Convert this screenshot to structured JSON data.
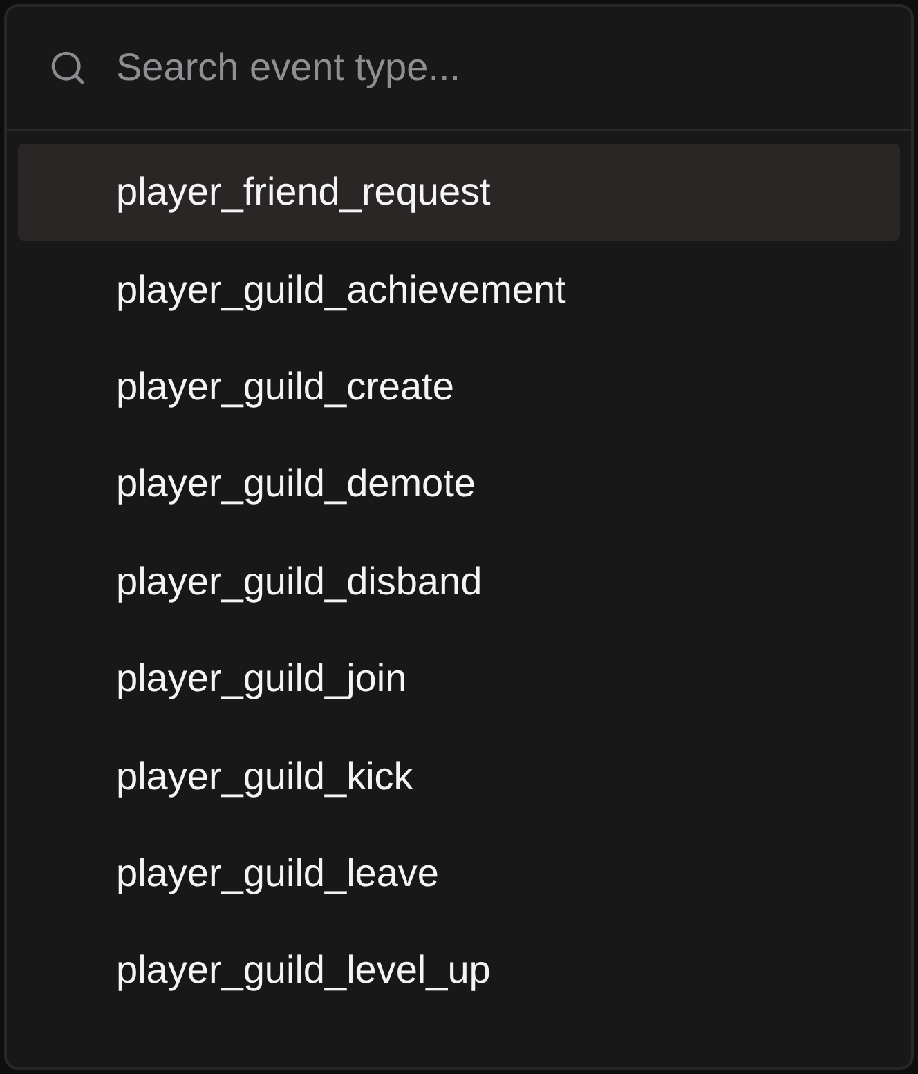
{
  "search": {
    "placeholder": "Search event type..."
  },
  "items": [
    {
      "label": "player_friend_request",
      "selected": true
    },
    {
      "label": "player_guild_achievement",
      "selected": false
    },
    {
      "label": "player_guild_create",
      "selected": false
    },
    {
      "label": "player_guild_demote",
      "selected": false
    },
    {
      "label": "player_guild_disband",
      "selected": false
    },
    {
      "label": "player_guild_join",
      "selected": false
    },
    {
      "label": "player_guild_kick",
      "selected": false
    },
    {
      "label": "player_guild_leave",
      "selected": false
    },
    {
      "label": "player_guild_level_up",
      "selected": false
    }
  ]
}
